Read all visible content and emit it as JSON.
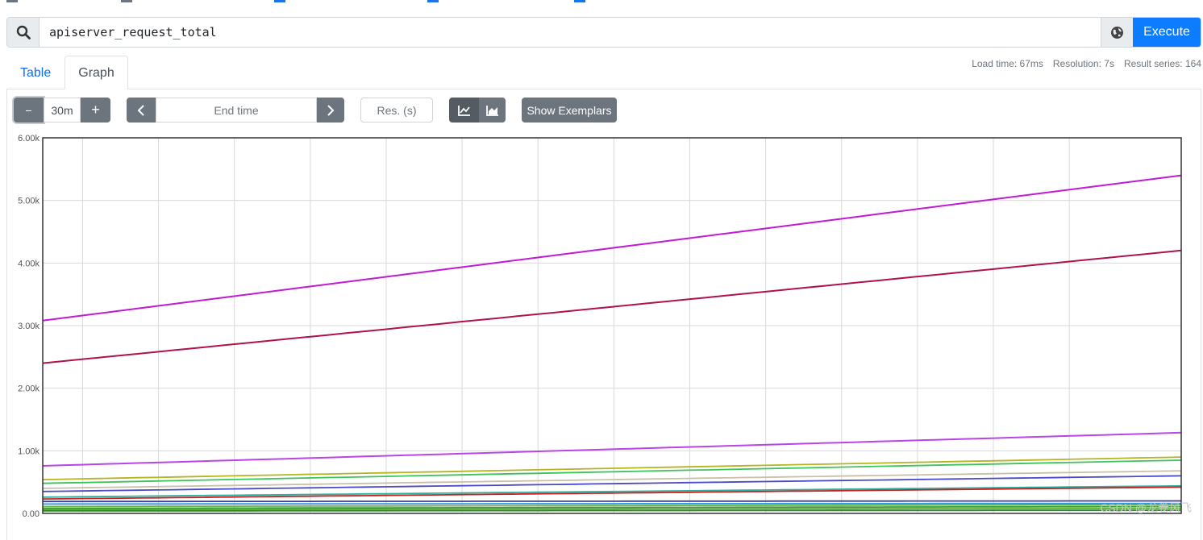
{
  "query": {
    "value": "apiserver_request_total",
    "execute_label": "Execute"
  },
  "tabs": [
    {
      "label": "Table",
      "active": false
    },
    {
      "label": "Graph",
      "active": true
    }
  ],
  "stats": {
    "load_time": "Load time: 67ms",
    "resolution": "Resolution: 7s",
    "result_series": "Result series: 164"
  },
  "controls": {
    "minus_label": "−",
    "range": "30m",
    "plus_label": "+",
    "end_time_placeholder": "End time",
    "resolution_placeholder": "Res. (s)",
    "exemplars_label": "Show Exemplars"
  },
  "icons": {
    "search": "search-icon",
    "globe": "globe-icon",
    "prev": "chevron-left-icon",
    "next": "chevron-right-icon",
    "line_chart": "line-chart-icon",
    "stacked_chart": "area-chart-icon"
  },
  "watermark": "CSDN @龙卷风飞",
  "chart_data": {
    "type": "line",
    "y_ticks": [
      "0.00",
      "1.00k",
      "2.00k",
      "3.00k",
      "4.00k",
      "5.00k",
      "6.00k"
    ],
    "ylim": [
      0,
      6000
    ],
    "x": [
      0,
      30
    ],
    "grid": true,
    "series": [
      {
        "values": [
          3080,
          5400
        ],
        "color": "#c21bd6"
      },
      {
        "values": [
          2400,
          4200
        ],
        "color": "#b0124f"
      },
      {
        "values": [
          760,
          1290
        ],
        "color": "#b845e6"
      },
      {
        "values": [
          540,
          900
        ],
        "color": "#b5b520"
      },
      {
        "values": [
          480,
          850
        ],
        "color": "#3bc45a"
      },
      {
        "values": [
          400,
          680
        ],
        "color": "#c8c0a8"
      },
      {
        "values": [
          350,
          600
        ],
        "color": "#4a4ac8"
      },
      {
        "values": [
          260,
          440
        ],
        "color": "#2ab0a0"
      },
      {
        "values": [
          230,
          420
        ],
        "color": "#c82020"
      },
      {
        "values": [
          190,
          200
        ],
        "color": "#3a3aa8"
      },
      {
        "values": [
          150,
          160
        ],
        "color": "#2a9ad8"
      },
      {
        "values": [
          110,
          140
        ],
        "color": "#6ab04a"
      },
      {
        "values": [
          80,
          110
        ],
        "color": "#3a9a3a"
      },
      {
        "values": [
          60,
          80
        ],
        "color": "#5ab030"
      },
      {
        "values": [
          40,
          50
        ],
        "color": "#2a8a2a"
      }
    ]
  }
}
